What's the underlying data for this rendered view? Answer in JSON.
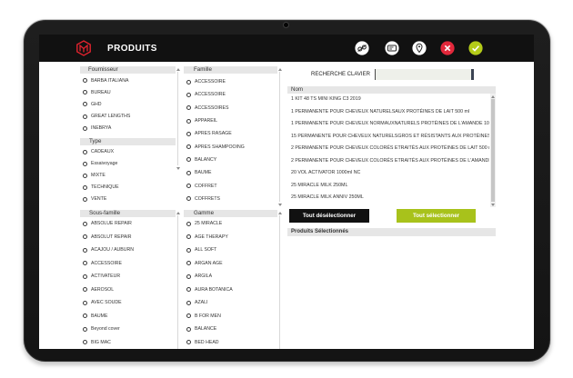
{
  "theme": {
    "header_bg": "#111111",
    "accent_green": "#a8c21b",
    "close_red": "#e3283b",
    "check_green": "#b4cb19",
    "panel_header_bg": "#e6e6e6"
  },
  "app": {
    "title": "PRODUITS"
  },
  "toolbar": {
    "icons": [
      {
        "name": "link-icon"
      },
      {
        "name": "card-icon"
      },
      {
        "name": "location-pin-icon"
      },
      {
        "name": "close-icon"
      },
      {
        "name": "check-icon"
      }
    ]
  },
  "filters": {
    "fournisseur": {
      "title": "Fournisseur",
      "items": [
        "BARBA ITALIANA",
        "BUREAU",
        "GHD",
        "GREAT LENGTHS",
        "INEBRYA"
      ]
    },
    "type": {
      "title": "Type",
      "items": [
        "CADEAUX",
        "Essaivoyage",
        "MIXTE",
        "TECHNIQUE",
        "VENTE"
      ]
    },
    "sous_famille": {
      "title": "Sous-famille",
      "items": [
        "ABSOLUE REPAIR",
        "ABSOLUT REPAIR",
        "ACAJOU / AUBURN",
        "ACCESSOIRE",
        "ACTIVATEUR",
        "AEROSOL",
        "AVEC SOUDE",
        "BAUME",
        "Beyond cover",
        "BIG MAC"
      ]
    },
    "famille": {
      "title": "Famille",
      "items": [
        "ACCESSOIRE",
        "ACCESSOIRE",
        "ACCESSOIRES",
        "APPAREIL",
        "APRES RASAGE",
        "APRES SHAMPOOING",
        "BALANCY",
        "BAUME",
        "COFFRET",
        "COFFRETS"
      ]
    },
    "gamme": {
      "title": "Gamme",
      "items": [
        "25 MIRACLE",
        "AGE THERAPY",
        "ALL SOFT",
        "ARGAN AGE",
        "ARGILA",
        "AURA BOTANICA",
        "AZALI",
        "B FOR MEN",
        "BALANCE",
        "BED HEAD"
      ]
    }
  },
  "search": {
    "label": "RECHERCHE CLAVIER",
    "value": ""
  },
  "products": {
    "column_header": "Nom",
    "items": [
      "1 KIT 48 TS MINI KING C3 2019",
      "1 PERMANENTE POUR CHEVEUX NATURELSAUX PROTÉINES DE LAIT 500 ml",
      "1 PERMANENTE POUR CHEVEUX NORMAUXNATURELS PROTÉINES DE L'AMANDE 10",
      "15 PERMANENTE POUR CHEVEUX NATURELSGROS ET RÉSISTANTS AUX PROTÉINES D",
      "2 PERMANENTE POUR CHEVEUX COLORÉS ETRAITÉS AUX PROTÉINES DE LAIT 500 m",
      "2 PERMANENTE POUR CHEVEUX COLORÉS ETRAITÉS AUX PROTÉINES DE L'AMANDE",
      "20 VOL ACTIVATOR 1000ml NC",
      "25 MIRACLE MILK 250ML",
      "25 MIRACLE MILK ANNIV 250ML"
    ]
  },
  "actions": {
    "deselect_all": "Tout désélectionner",
    "select_all": "Tout sélectionner"
  },
  "selected": {
    "title": "Produits Sélectionnés",
    "items": []
  }
}
